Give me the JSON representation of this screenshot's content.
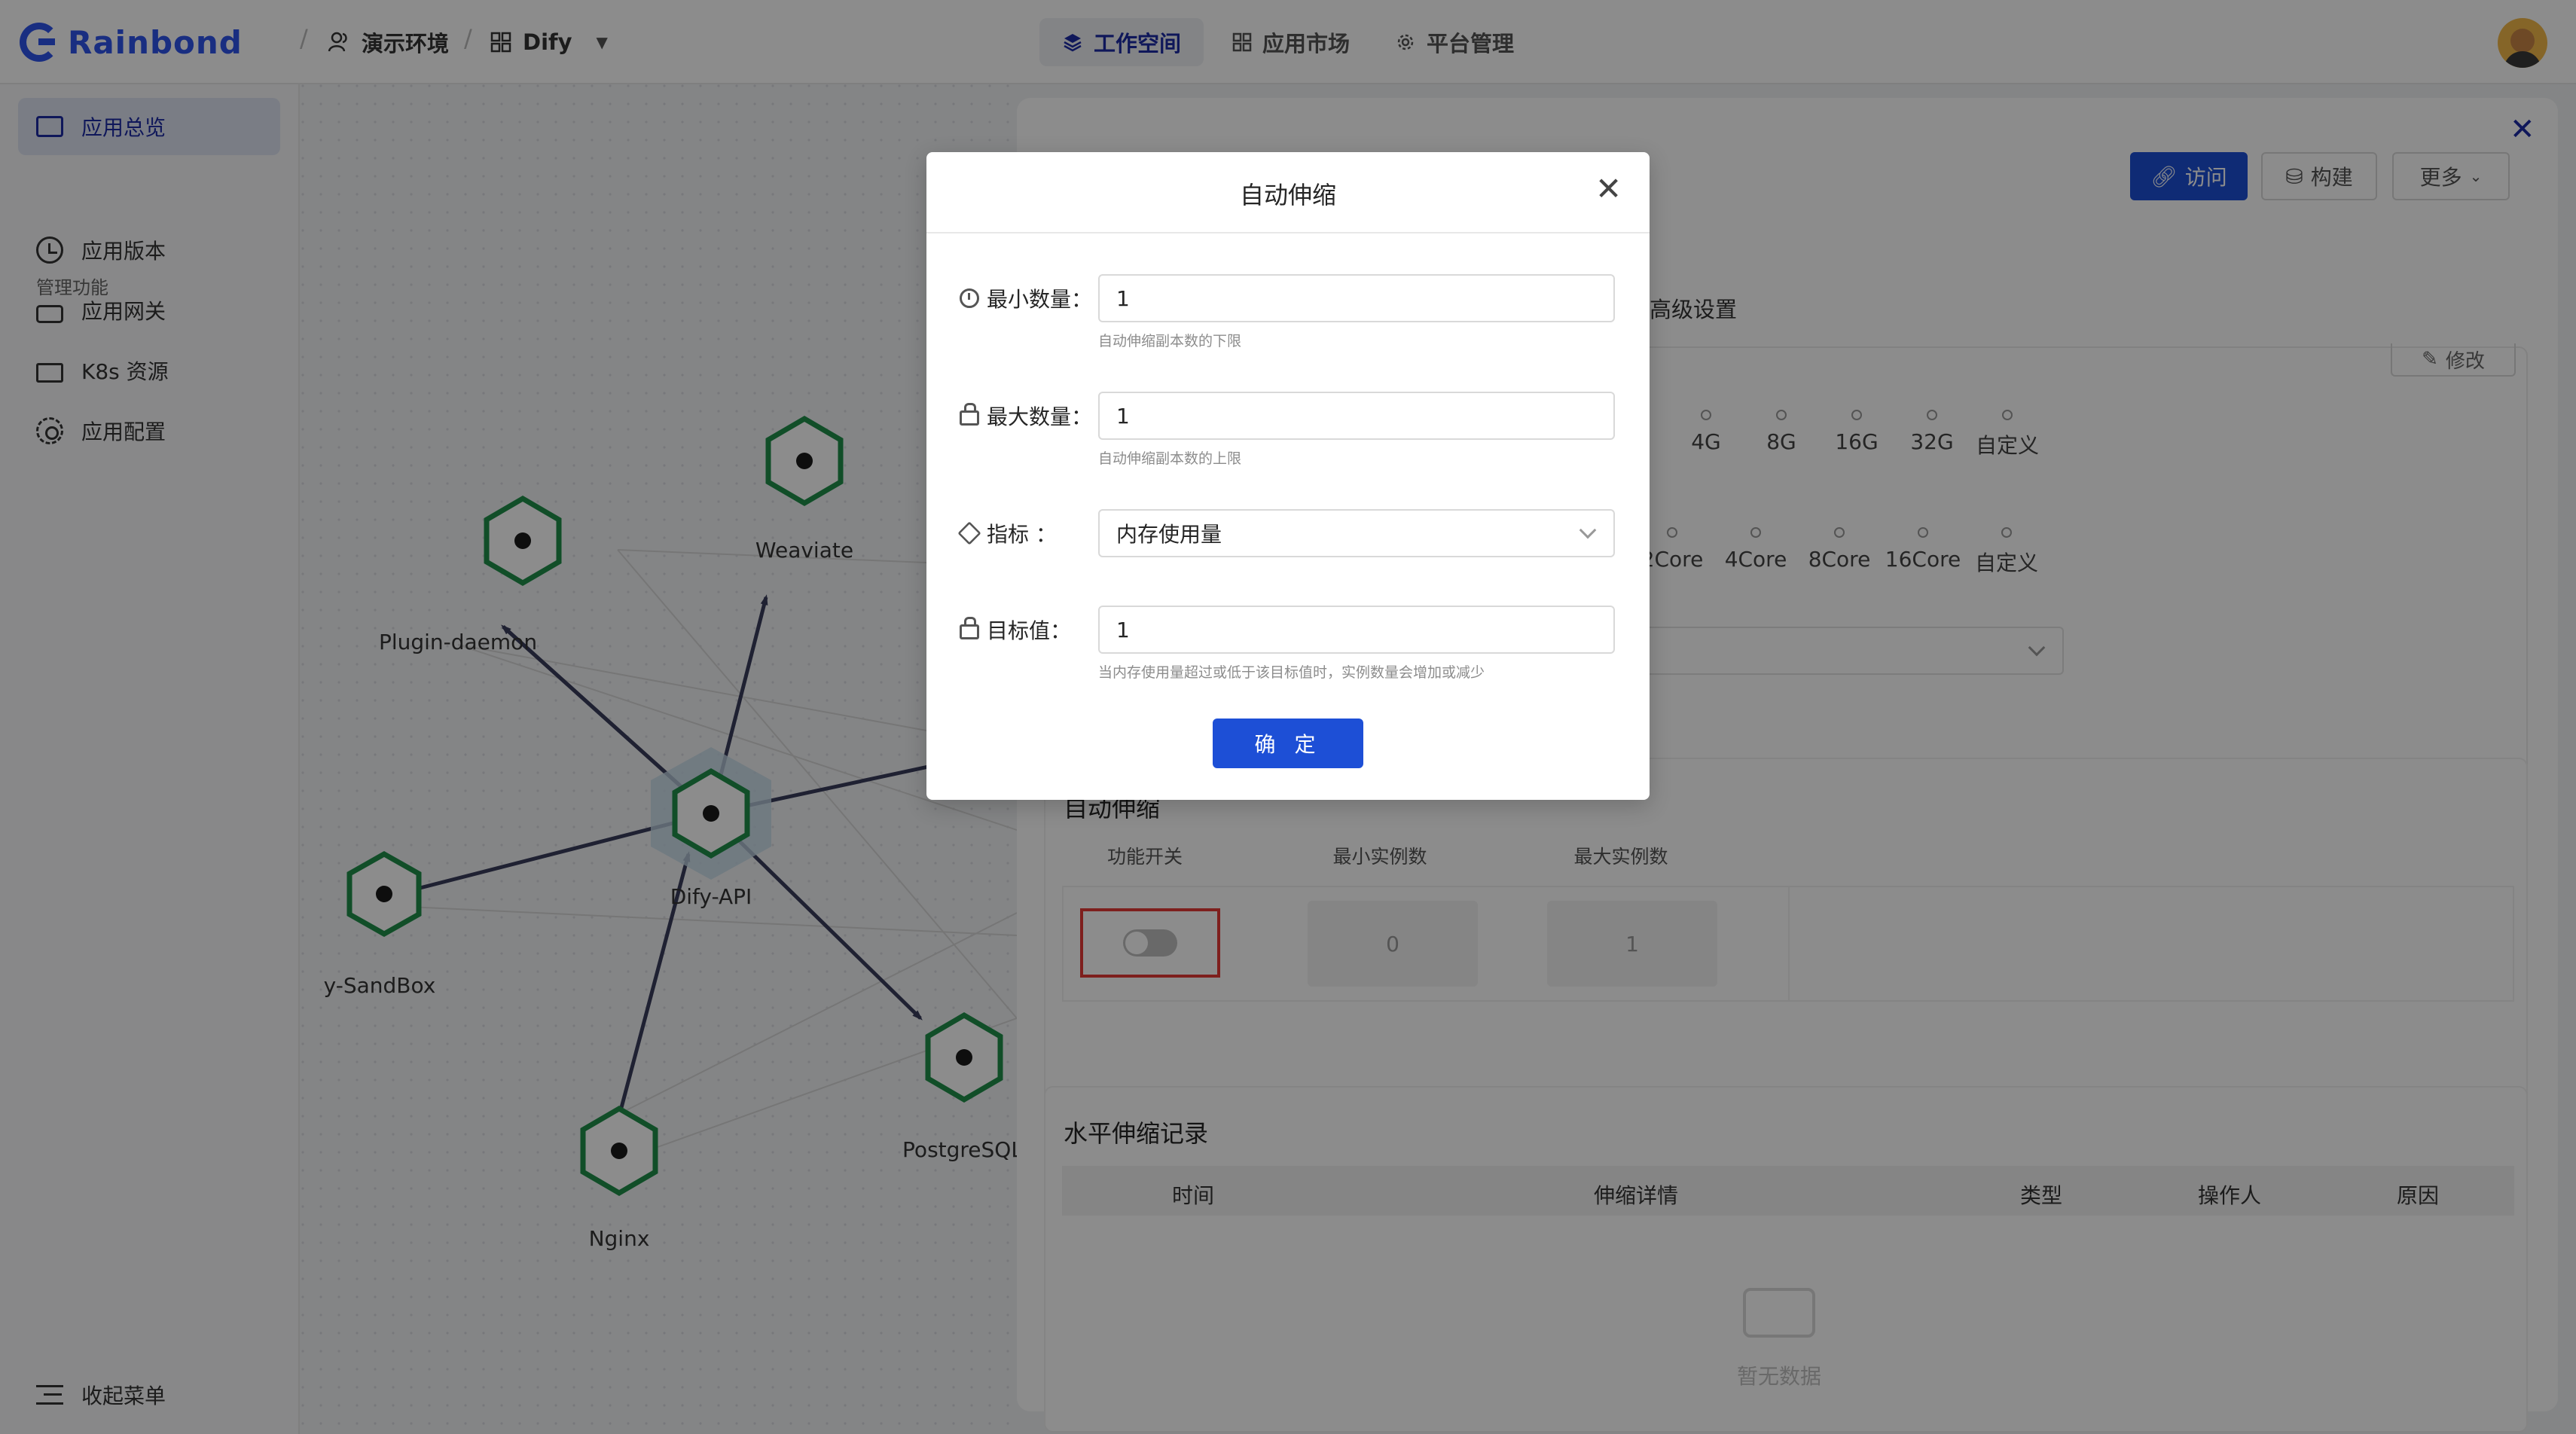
{
  "header": {
    "brand": "Rainbond",
    "environment": "演示环境",
    "app": "Dify",
    "nav": [
      {
        "label": "工作空间",
        "active": true
      },
      {
        "label": "应用市场",
        "active": false
      },
      {
        "label": "平台管理",
        "active": false
      }
    ]
  },
  "sidebar": {
    "overview": "应用总览",
    "section_title": "管理功能",
    "items": [
      "应用版本",
      "应用网关",
      "K8s 资源",
      "应用配置"
    ],
    "collapse": "收起菜单"
  },
  "topology": {
    "nodes": [
      "Plugin-daemon",
      "Weaviate",
      "Dify-API",
      "y-SandBox",
      "Nginx",
      "PostgreSQL"
    ],
    "colors": {
      "node_border": "#1f8f4a",
      "edge": "#3a3d5c",
      "focus": "#c5dbe8"
    }
  },
  "drawer": {
    "buttons": {
      "visit": "访问",
      "build": "构建",
      "more": "更多"
    },
    "tab_advanced": "高级设置",
    "edit": "修改",
    "memory_options": [
      "4G",
      "8G",
      "16G",
      "32G",
      "自定义"
    ],
    "cpu_options": [
      "2Core",
      "4Core",
      "8Core",
      "16Core",
      "自定义"
    ],
    "autoscale": {
      "title": "自动伸缩",
      "col_switch": "功能开关",
      "col_min": "最小实例数",
      "col_max": "最大实例数",
      "min_value": "0",
      "max_value": "1",
      "enabled": false
    },
    "records": {
      "title": "水平伸缩记录",
      "columns": [
        "时间",
        "伸缩详情",
        "类型",
        "操作人",
        "原因"
      ],
      "empty": "暂无数据"
    }
  },
  "modal": {
    "title": "自动伸缩",
    "fields": {
      "min": {
        "label": "最小数量：",
        "value": "1",
        "help": "自动伸缩副本数的下限"
      },
      "max": {
        "label": "最大数量：",
        "value": "1",
        "help": "自动伸缩副本数的上限"
      },
      "metric": {
        "label": "指标 ：",
        "value": "内存使用量"
      },
      "target": {
        "label": "目标值：",
        "value": "1",
        "help": "当内存使用量超过或低于该目标值时，实例数量会增加或减少"
      }
    },
    "confirm": "确 定"
  },
  "colors": {
    "primary": "#1d4fd6",
    "brand": "#2f54eb",
    "highlight_box": "#e53935"
  }
}
